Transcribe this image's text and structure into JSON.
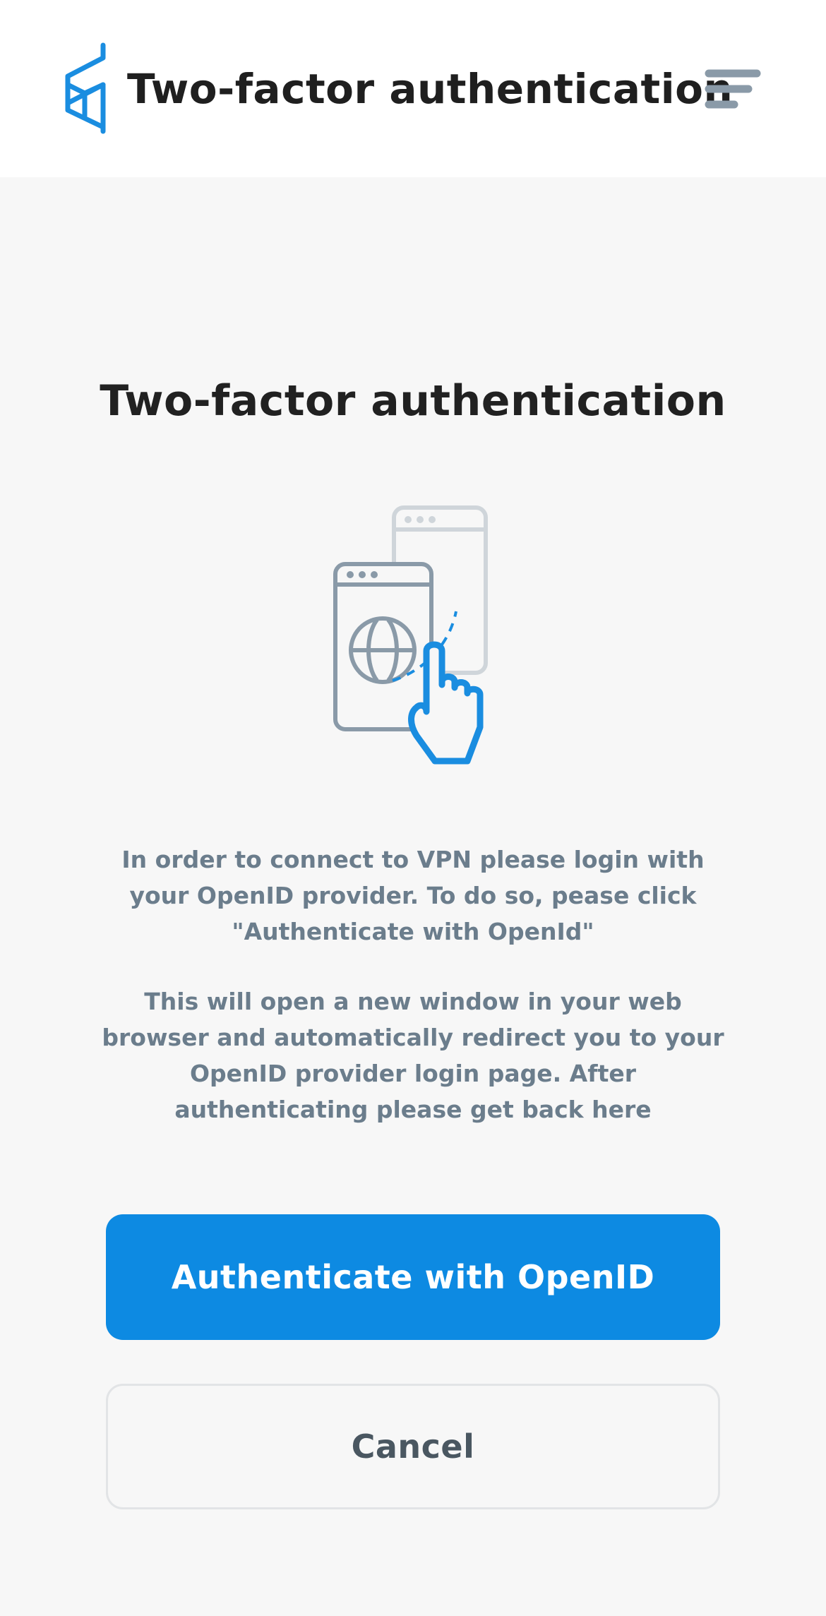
{
  "header": {
    "title": "Two-factor authentication",
    "logo_icon": "hexagon-logo-icon",
    "menu_icon": "hamburger-menu-icon"
  },
  "main": {
    "title": "Two-factor authentication",
    "illustration_icon": "tap-to-open-browser-illustration",
    "paragraphs": [
      "In order to connect to VPN please login with your OpenID provider. To do so, pease click \"Authenticate with OpenId\"",
      "This will open a new window in your web browser and automatically redirect you to your OpenID provider login page. After authenticating please get back here"
    ]
  },
  "buttons": {
    "authenticate_label": "Authenticate with OpenID",
    "cancel_label": "Cancel"
  },
  "colors": {
    "accent": "#0d8ae2",
    "page_background": "#f7f7f7",
    "header_background": "#ffffff",
    "title_text": "#212121",
    "body_text": "#6b7d8c",
    "icon_gray": "#8a9aa8"
  }
}
